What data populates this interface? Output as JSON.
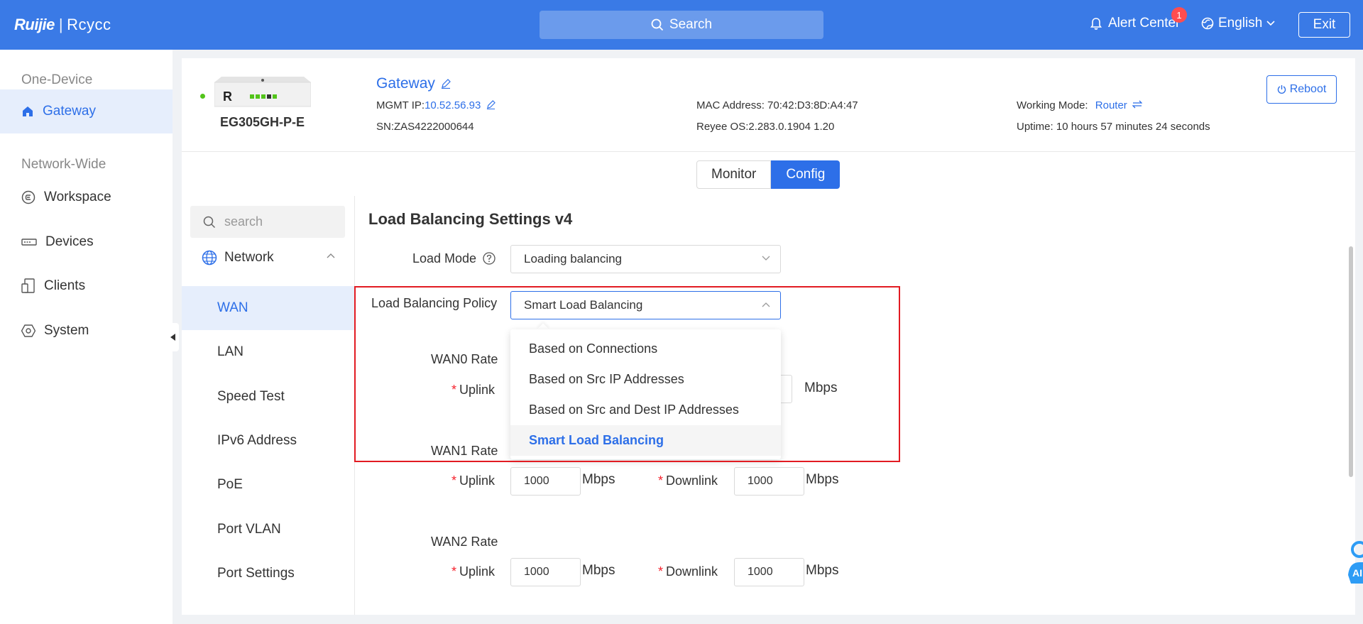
{
  "topbar": {
    "brand": "Ruijie",
    "brand_sub": "Rcycc",
    "search_label": "Search",
    "alert_label": "Alert Center",
    "alert_count": "1",
    "language": "English",
    "exit_label": "Exit"
  },
  "sidebar": {
    "section1": "One-Device",
    "section2": "Network-Wide",
    "items": [
      {
        "label": "Gateway"
      },
      {
        "label": "Workspace"
      },
      {
        "label": "Devices"
      },
      {
        "label": "Clients"
      },
      {
        "label": "System"
      }
    ]
  },
  "device": {
    "model": "EG305GH-P-E",
    "name": "Gateway",
    "mgmt_ip_label": "MGMT IP:",
    "mgmt_ip": "10.52.56.93",
    "sn": "SN:ZAS4222000644",
    "mac": "MAC Address: 70:42:D3:8D:A4:47",
    "os": "Reyee OS:2.283.0.1904 1.20",
    "working_mode_label": "Working Mode:",
    "working_mode": "Router",
    "uptime": "Uptime: 10 hours 57 minutes 24 seconds",
    "reboot_label": "Reboot"
  },
  "tabs": {
    "monitor": "Monitor",
    "config": "Config"
  },
  "left_nav": {
    "search_placeholder": "search",
    "group": "Network",
    "items": [
      {
        "label": "WAN"
      },
      {
        "label": "LAN"
      },
      {
        "label": "Speed Test"
      },
      {
        "label": "IPv6 Address"
      },
      {
        "label": "PoE"
      },
      {
        "label": "Port VLAN"
      },
      {
        "label": "Port Settings"
      }
    ]
  },
  "form": {
    "title": "Load Balancing Settings v4",
    "load_mode_label": "Load Mode",
    "load_mode_value": "Loading balancing",
    "policy_label": "Load Balancing Policy",
    "policy_value": "Smart Load Balancing",
    "policy_options": [
      "Based on Connections",
      "Based on Src IP Addresses",
      "Based on Src and Dest IP Addresses",
      "Smart Load Balancing"
    ],
    "wan0_label": "WAN0 Rate",
    "wan1_label": "WAN1 Rate",
    "wan2_label": "WAN2 Rate",
    "uplink_label": "Uplink",
    "downlink_label": "Downlink",
    "unit": "Mbps",
    "wan1_uplink": "1000",
    "wan1_downlink": "1000",
    "wan2_uplink": "1000",
    "wan2_downlink": "1000",
    "req_mark": "*"
  }
}
